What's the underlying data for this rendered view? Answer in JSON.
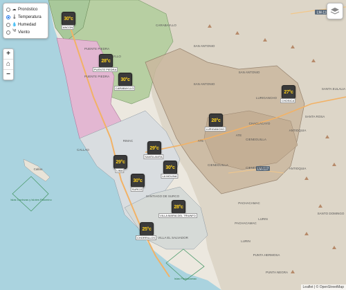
{
  "layer_panel": {
    "items": [
      {
        "label": "Pronóstico",
        "icon": "cloud-icon",
        "selected": false
      },
      {
        "label": "Temperatura",
        "icon": "thermometer-icon",
        "selected": true
      },
      {
        "label": "Humedad",
        "icon": "droplet-icon",
        "selected": false
      },
      {
        "label": "Viento",
        "icon": "wind-icon",
        "selected": false
      }
    ]
  },
  "zoom": {
    "in": "+",
    "home_icon": "home-icon",
    "out": "−"
  },
  "layers_button_icon": "layers-icon",
  "attribution": "Leaflet | © OpenStreetMap",
  "road_labels": {
    "lm116": "LM-116",
    "lm117": "LM-117"
  },
  "place_labels": [
    {
      "text": "CARABAYLLO"
    },
    {
      "text": "CARABAYLLO"
    },
    {
      "text": "SAN ANTONIO"
    },
    {
      "text": "SAN ANTONIO"
    },
    {
      "text": "SAN ANTONIO"
    },
    {
      "text": "LURIGANCHO"
    },
    {
      "text": "CHACLACAYO"
    },
    {
      "text": "CIENEGUILLA"
    },
    {
      "text": "CIENEGUILLA"
    },
    {
      "text": "CIENEGUILLA"
    },
    {
      "text": "ANTIOQUIA"
    },
    {
      "text": "ANTIOQUIA"
    },
    {
      "text": "SANTA EULALIA"
    },
    {
      "text": "SANTO DOMINGO"
    },
    {
      "text": "PUENTE PIEDRA"
    },
    {
      "text": "PUENTE PIEDRA"
    },
    {
      "text": "CALLAO"
    },
    {
      "text": "PACHACAMAC"
    },
    {
      "text": "PACHACAMAC"
    },
    {
      "text": "LURIN"
    },
    {
      "text": "LURIN"
    },
    {
      "text": "PUNTA HERMOSA"
    },
    {
      "text": "PUNTA NEGRA"
    },
    {
      "text": "ATE"
    },
    {
      "text": "ATE"
    },
    {
      "text": "SANTA ROSA"
    },
    {
      "text": "VILLA EL SALVADOR"
    },
    {
      "text": "SANTIAGO DE SURCO"
    },
    {
      "text": "RIMAC"
    },
    {
      "text": "Callao"
    }
  ],
  "protected_areas": [
    {
      "label": "Islas Cavinzas y Islotes Palomino"
    },
    {
      "label": "Islas Pachacamac"
    }
  ],
  "stations": [
    {
      "temp": "30°c",
      "name": "ANCON"
    },
    {
      "temp": "28°c",
      "name": "PUENTE PIEDRA"
    },
    {
      "temp": "30°c",
      "name": "CARABAYLLO"
    },
    {
      "temp": "27°c",
      "name": "CHOSICA"
    },
    {
      "temp": "28°c",
      "name": "LURIGANCHO"
    },
    {
      "temp": "29°c",
      "name": "SANTA ANITA"
    },
    {
      "temp": "29°c",
      "name": "LIMA"
    },
    {
      "temp": "30°c",
      "name": "LA MOLINA"
    },
    {
      "temp": "30°c",
      "name": "SURCO"
    },
    {
      "temp": "28°c",
      "name": "VILLA MARIA DEL TRIUNFO"
    },
    {
      "temp": "25°c",
      "name": "CHORRILLOS"
    }
  ],
  "colors": {
    "sea": "#aad3df",
    "land": "#f2efe9",
    "urban": "#e0dfdf",
    "hills": "#d7d0c0",
    "green": "#a9c79a",
    "pink": "#e8b6d6",
    "tan": "#c9b6a0",
    "badge_text": "#ffd21f"
  }
}
